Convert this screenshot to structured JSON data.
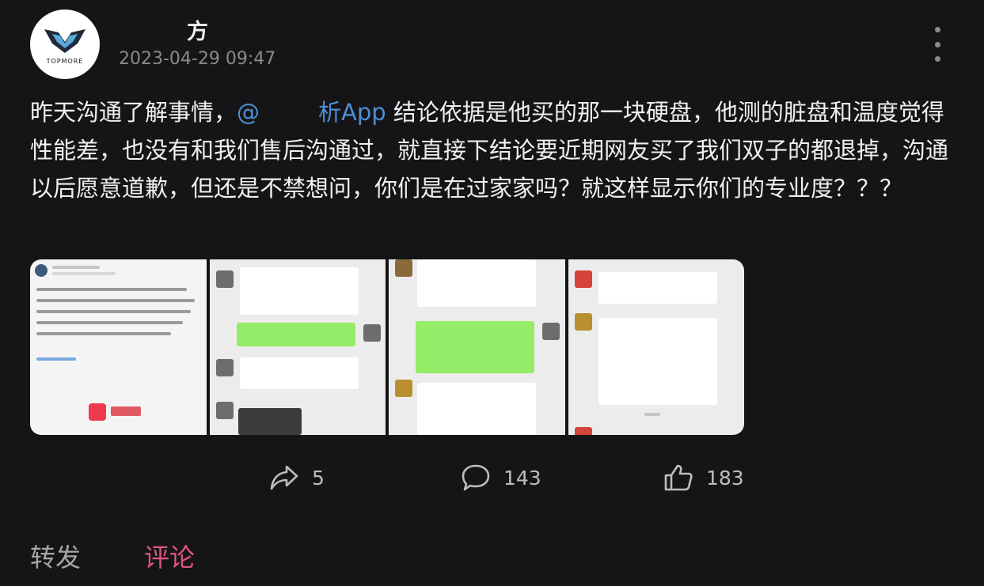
{
  "post": {
    "username": "方",
    "timestamp": "2023-04-29 09:47",
    "avatar_brand": "TOPMORE",
    "text_before": "昨天沟通了解事情，",
    "mention_prefix": "@",
    "mention_suffix": "析App",
    "text_after": " 结论依据是他买的那一块硬盘，他测的脏盘和温度觉得性能差，也没有和我们售后沟通过，就直接下结论要近期网友买了我们双子的都退掉，沟通以后愿意道歉，但还是不禁想问，你们是在过家家吗？就这样显示你们的专业度？？？"
  },
  "actions": {
    "share_count": "5",
    "comment_count": "143",
    "like_count": "183"
  },
  "tabs": {
    "repost": "转发",
    "comment": "评论"
  },
  "icons": {
    "share": "share-arrow-icon",
    "comment": "comment-bubble-icon",
    "like": "thumbs-up-icon",
    "more": "more-vertical-icon"
  },
  "colors": {
    "background": "#151517",
    "mention": "#4e8fd6",
    "active_tab": "#e0557d",
    "chat_green": "#95ec69"
  }
}
